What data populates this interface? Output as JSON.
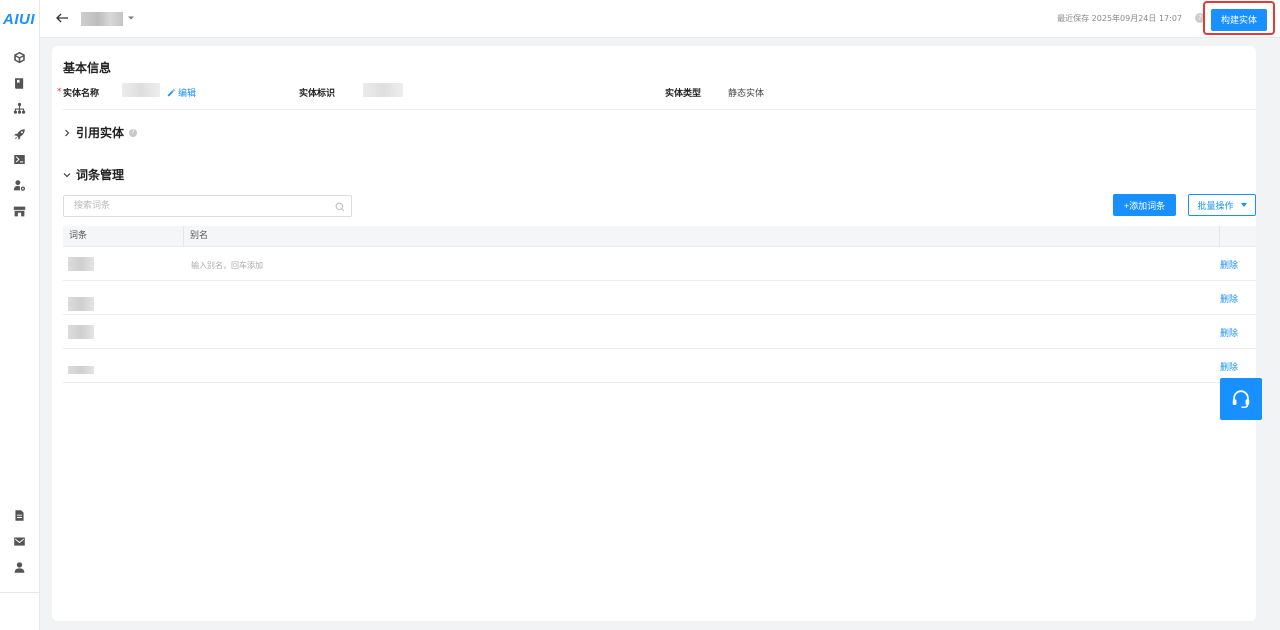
{
  "app": {
    "logo_text": "AIUI"
  },
  "sidebar": {
    "top_icons": [
      "cube-icon",
      "book-icon",
      "network-icon",
      "rocket-icon",
      "terminal-icon",
      "user-settings-icon",
      "store-icon"
    ],
    "bottom_icons": [
      "document-icon",
      "mail-icon",
      "user-icon"
    ]
  },
  "topbar": {
    "save_time": "最近保存 2025年09月24日 17:07",
    "help": "?",
    "build_label": "构建实体"
  },
  "basic_info": {
    "title": "基本信息",
    "required_mark": "*",
    "name_label": "实体名称",
    "edit_label": "编辑",
    "id_label": "实体标识",
    "type_label": "实体类型",
    "type_value": "静态实体"
  },
  "ref_section": {
    "title": "引用实体",
    "info": "?"
  },
  "terms_section": {
    "title": "词条管理",
    "search_placeholder": "搜索词条",
    "add_label": "+添加词条",
    "batch_label": "批量操作"
  },
  "table": {
    "columns": [
      "词条",
      "别名"
    ],
    "alias_placeholder": "输入别名，回车添加",
    "rows": [
      {
        "delete_label": "删除"
      },
      {
        "delete_label": "删除"
      },
      {
        "delete_label": "删除"
      },
      {
        "delete_label": "删除"
      }
    ]
  },
  "colors": {
    "primary": "#1890ff",
    "highlight_border": "#e53935"
  }
}
